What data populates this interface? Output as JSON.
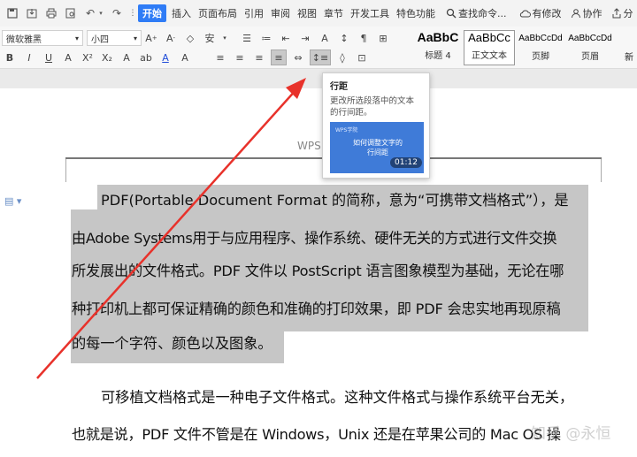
{
  "menubar": {
    "tabs": [
      "开始",
      "插入",
      "页面布局",
      "引用",
      "审阅",
      "视图",
      "章节",
      "开发工具",
      "特色功能"
    ],
    "active_tab": "开始",
    "search_label": "查找命令...",
    "modified_label": "有修改",
    "collab_label": "协作",
    "share_label": "分"
  },
  "ribbon": {
    "font_name": "微软雅黑",
    "font_size": "小四",
    "styles": [
      {
        "sample": "AaBbC",
        "name": "标题 4"
      },
      {
        "sample": "AaBbCc",
        "name": "正文文本"
      },
      {
        "sample": "AaBbCcDd",
        "name": "页脚"
      },
      {
        "sample": "AaBbCcDd",
        "name": "页眉"
      }
    ],
    "more_label": "新"
  },
  "tooltip": {
    "title": "行距",
    "description": "更改所选段落中的文本的行间距。",
    "video_brand": "WPS学院",
    "video_title": "如何调整文字的行间距",
    "video_duration": "01:12"
  },
  "document": {
    "header_text": "WPS",
    "selected_lines": [
      "PDF(Portable Document Format 的简称，意为“可携带文档格式”），是",
      "由Adobe Systems用于与应用程序、操作系统、硬件无关的方式进行文件交换",
      "所发展出的文件格式。PDF 文件以 PostScript 语言图象模型为基础，无论在哪",
      "种打印机上都可保证精确的颜色和准确的打印效果，即 PDF 会忠实地再现原稿",
      "的每一个字符、颜色以及图象。"
    ],
    "lines": [
      "可移植文档格式是一种电子文件格式。这种文件格式与操作系统平台无关，",
      "也就是说，PDF 文件不管是在 Windows，Unix 还是在苹果公司的 Mac OS 操"
    ]
  },
  "watermark": "知乎 @永恒",
  "colors": {
    "accent": "#2f7cf6",
    "arrow": "#e8322b",
    "selection": "#c6c6c6"
  }
}
